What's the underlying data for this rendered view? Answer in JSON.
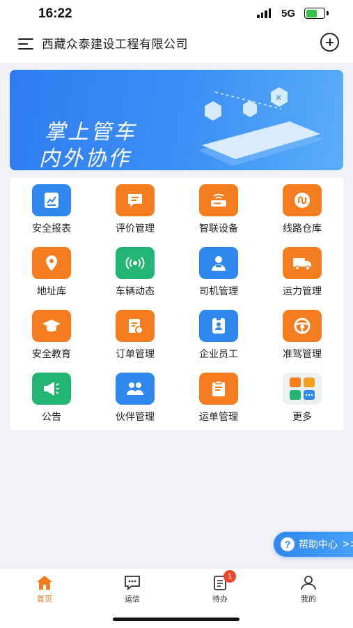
{
  "status": {
    "time": "16:22",
    "network": "5G"
  },
  "header": {
    "title": "西藏众泰建设工程有限公司"
  },
  "banner": {
    "line1": "掌上管车",
    "line2": "内外协作"
  },
  "grid": [
    {
      "label": "安全报表",
      "icon": "report-chart-icon",
      "color": "#2f88ee"
    },
    {
      "label": "评价管理",
      "icon": "comment-icon",
      "color": "#f57c1f"
    },
    {
      "label": "智联设备",
      "icon": "device-icon",
      "color": "#f57c1f"
    },
    {
      "label": "线路仓库",
      "icon": "route-icon",
      "color": "#f57c1f"
    },
    {
      "label": "地址库",
      "icon": "location-pin-icon",
      "color": "#f57c1f"
    },
    {
      "label": "车辆动态",
      "icon": "signal-waves-icon",
      "color": "#22b573"
    },
    {
      "label": "司机管理",
      "icon": "driver-icon",
      "color": "#2f88ee"
    },
    {
      "label": "运力管理",
      "icon": "truck-icon",
      "color": "#f57c1f"
    },
    {
      "label": "安全教育",
      "icon": "graduation-cap-icon",
      "color": "#f57c1f"
    },
    {
      "label": "订单管理",
      "icon": "order-icon",
      "color": "#f57c1f"
    },
    {
      "label": "企业员工",
      "icon": "id-badge-icon",
      "color": "#2f88ee"
    },
    {
      "label": "准驾管理",
      "icon": "steering-wheel-icon",
      "color": "#f57c1f"
    },
    {
      "label": "公告",
      "icon": "megaphone-icon",
      "color": "#22b573"
    },
    {
      "label": "伙伴管理",
      "icon": "partners-icon",
      "color": "#2f88ee"
    },
    {
      "label": "运单管理",
      "icon": "waybill-icon",
      "color": "#f57c1f"
    },
    {
      "label": "更多",
      "icon": "more-apps-icon",
      "color": "#eef0f3"
    }
  ],
  "help": {
    "label": "帮助中心",
    "arrow": ">>"
  },
  "tabs": [
    {
      "label": "首页",
      "icon": "home-icon",
      "active": true
    },
    {
      "label": "运信",
      "icon": "message-icon",
      "active": false
    },
    {
      "label": "待办",
      "icon": "todo-icon",
      "active": false,
      "badge": "1"
    },
    {
      "label": "我的",
      "icon": "user-icon",
      "active": false
    }
  ],
  "colors": {
    "accent": "#2f88ee",
    "orange": "#f57c1f",
    "green": "#22b573"
  }
}
